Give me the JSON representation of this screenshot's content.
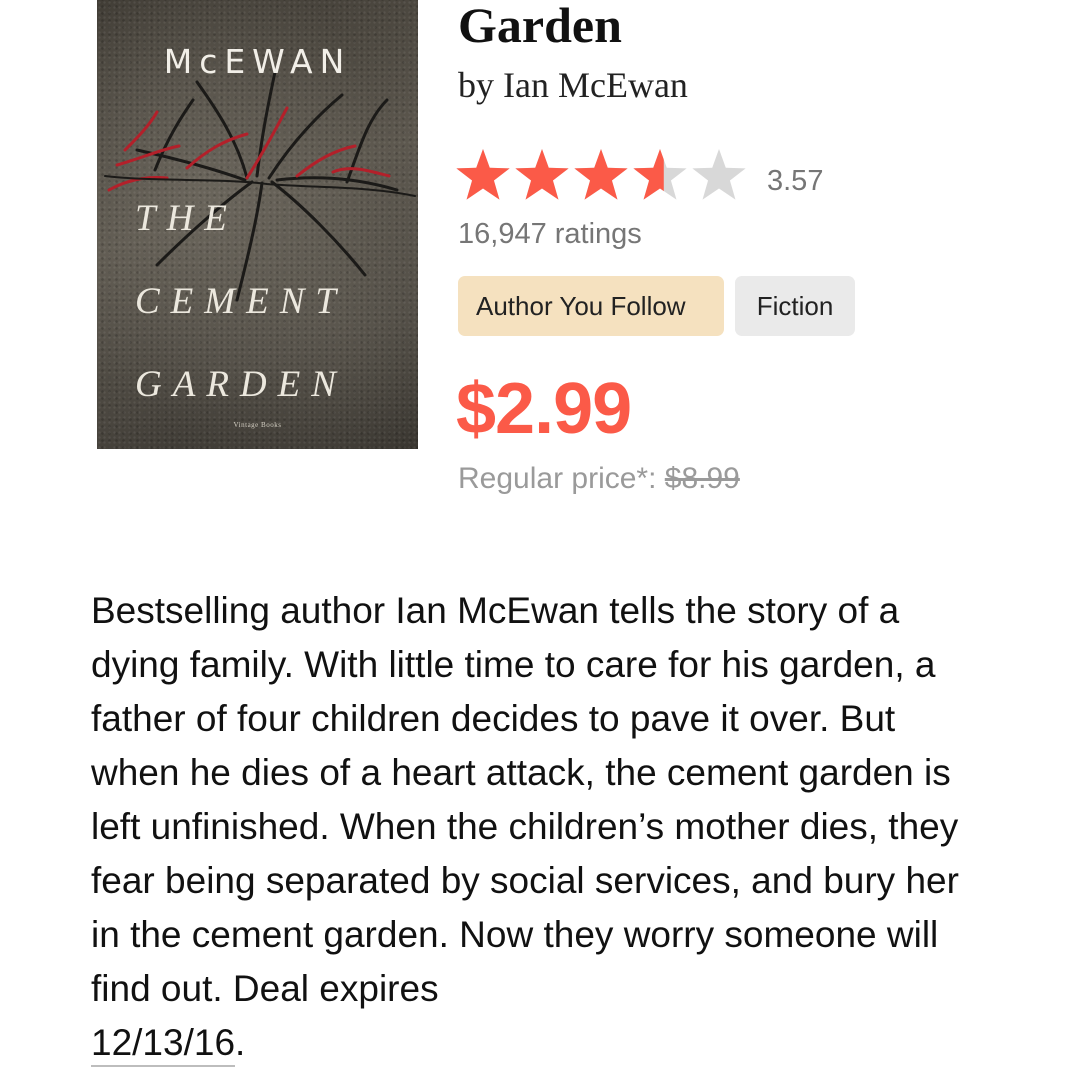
{
  "book": {
    "cover": {
      "author": "McEWAN",
      "title_lines": [
        "THE",
        "CEMENT",
        "GARDEN"
      ],
      "publisher": "Vintage Books"
    },
    "title": "Garden",
    "byline": "by Ian McEwan",
    "rating": {
      "stars": 3.57,
      "max_stars": 5,
      "value_text": "3.57",
      "count_text": "16,947 ratings",
      "filled_color": "#fb5a48",
      "empty_color": "#d8d8d8"
    },
    "tags": [
      {
        "label": "Author You Follow",
        "color": "#f5e1bf"
      },
      {
        "label": "Fiction",
        "color": "#eaeaea"
      }
    ],
    "price": "$2.99",
    "price_color": "#fb5a48",
    "regular_price_label": "Regular price*:",
    "regular_price": "$8.99",
    "description": "Bestselling author Ian McEwan tells the story of a dying family. With little time to care for his garden, a father of four children decides to pave it over. But when he dies of a heart attack, the cement garden is left unfinished. When the children’s mother dies, they fear being separated by social services, and bury her in the cement garden. Now they worry someone will find out. Deal expires",
    "deal_date": "12/13/16",
    "deal_date_suffix": "."
  }
}
